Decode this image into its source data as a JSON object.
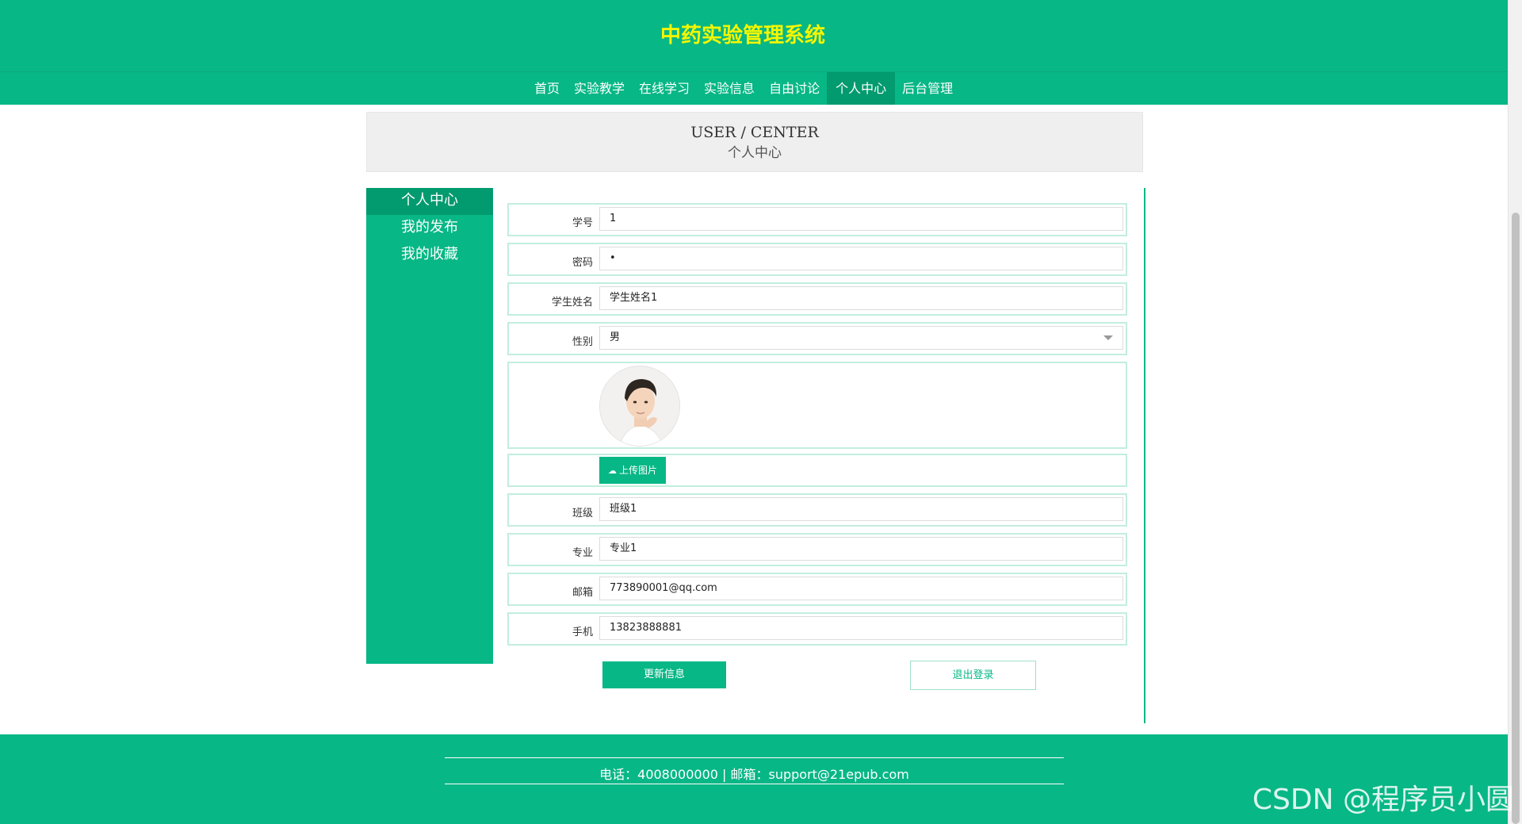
{
  "header": {
    "site_title": "中药实验管理系统"
  },
  "nav": {
    "items": [
      {
        "label": "首页"
      },
      {
        "label": "实验教学"
      },
      {
        "label": "在线学习"
      },
      {
        "label": "实验信息"
      },
      {
        "label": "自由讨论"
      },
      {
        "label": "个人中心",
        "active": true
      },
      {
        "label": "后台管理"
      }
    ]
  },
  "banner": {
    "english": "USER / CENTER",
    "chinese": "个人中心"
  },
  "side_menu": {
    "items": [
      {
        "label": "个人中心",
        "active": true
      },
      {
        "label": "我的发布"
      },
      {
        "label": "我的收藏"
      }
    ]
  },
  "form": {
    "student_id": {
      "label": "学号",
      "value": "1"
    },
    "password": {
      "label": "密码",
      "value": "•"
    },
    "student_name": {
      "label": "学生姓名",
      "value": "学生姓名1"
    },
    "gender": {
      "label": "性别",
      "value": "男"
    },
    "upload_label": "上传图片",
    "class_name": {
      "label": "班级",
      "value": "班级1"
    },
    "major": {
      "label": "专业",
      "value": "专业1"
    },
    "email": {
      "label": "邮箱",
      "value": "773890001@qq.com"
    },
    "phone": {
      "label": "手机",
      "value": "13823888881"
    },
    "update_button": "更新信息",
    "logout_button": "退出登录"
  },
  "footer": {
    "contact": "电话：4008000000 | 邮箱：support@21epub.com"
  },
  "watermark": "CSDN @程序员小圆",
  "colors": {
    "primary": "#07b786",
    "primary_dark": "#029a6f",
    "title_yellow": "#f5f600"
  },
  "icons": {
    "upload": "cloud-upload-icon",
    "select": "chevron-down-icon"
  }
}
